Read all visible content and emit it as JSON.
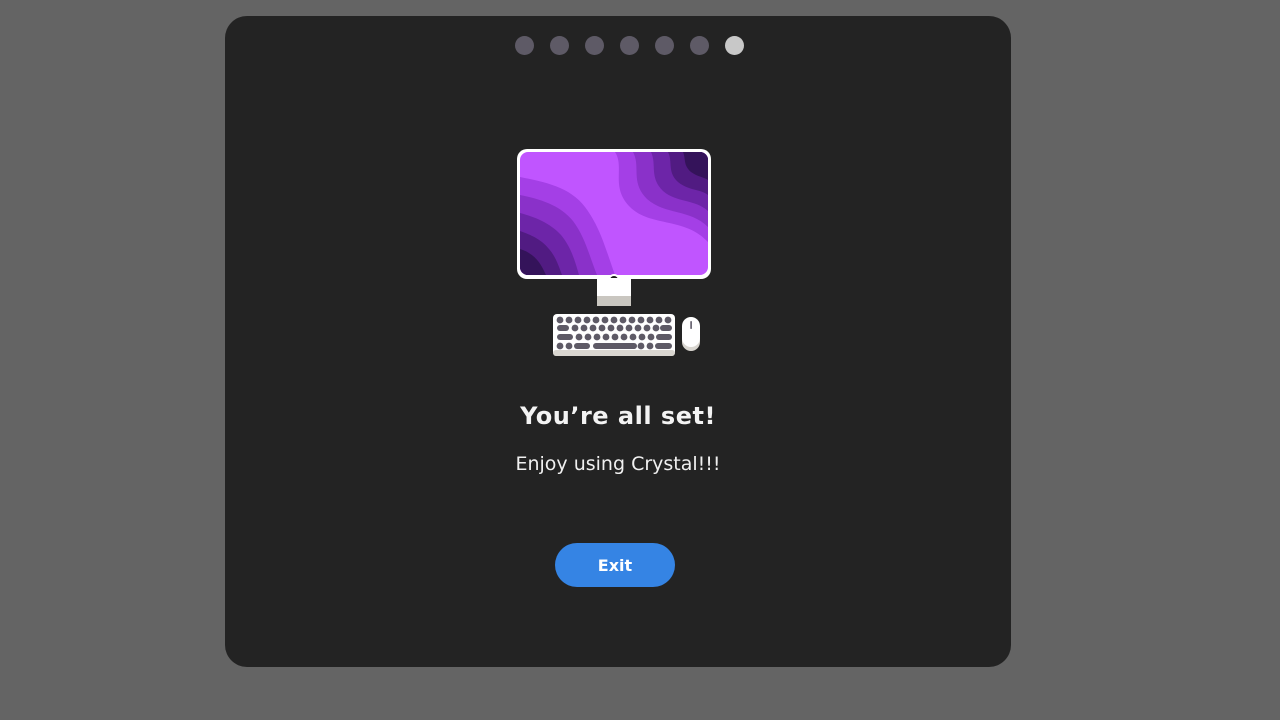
{
  "pager": {
    "count": 7,
    "active_index": 6
  },
  "content": {
    "title": "You’re all set!",
    "subtitle": "Enjoy using Crystal!!!"
  },
  "actions": {
    "exit_label": "Exit"
  },
  "colors": {
    "background": "#646464",
    "window": "#232323",
    "accent": "#3584e4",
    "dot_inactive": "#5e5a66",
    "dot_active": "#c8c8c8",
    "wallpaper": "#c055ff"
  },
  "icons": {
    "illustration": "desktop-computer-icon"
  }
}
